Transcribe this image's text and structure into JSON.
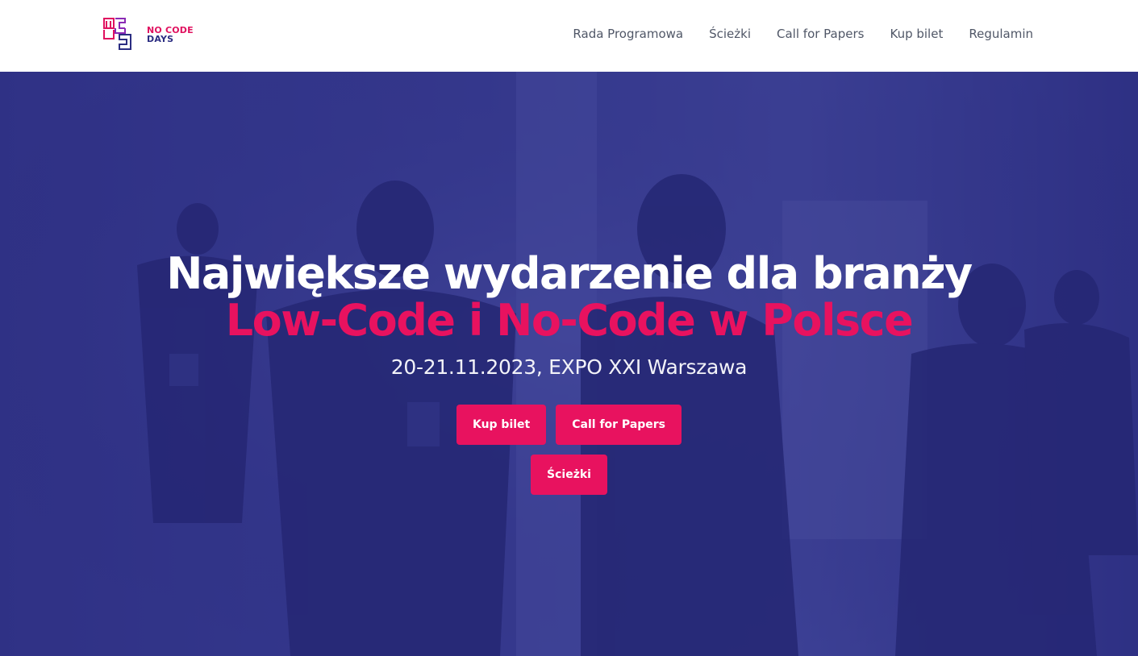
{
  "brand": {
    "logo_line1": "NO CODE",
    "logo_line2": "DAYS",
    "logo_icon": "ncd-monogram-icon",
    "accent_color": "#e8125f",
    "brand_blue": "#2b2d82"
  },
  "nav": {
    "items": [
      {
        "label": "Rada Programowa"
      },
      {
        "label": "Ścieżki"
      },
      {
        "label": "Call for Papers"
      },
      {
        "label": "Kup bilet"
      },
      {
        "label": "Regulamin"
      }
    ]
  },
  "hero": {
    "headline_line1": "Największe wydarzenie dla branży",
    "headline_line2": "Low-Code i No-Code w Polsce",
    "subtitle": "20-21.11.2023, EXPO XXI Warszawa",
    "buttons": [
      {
        "label": "Kup bilet"
      },
      {
        "label": "Call for Papers"
      },
      {
        "label": "Ścieżki"
      }
    ],
    "overlay_color": "#242478"
  }
}
